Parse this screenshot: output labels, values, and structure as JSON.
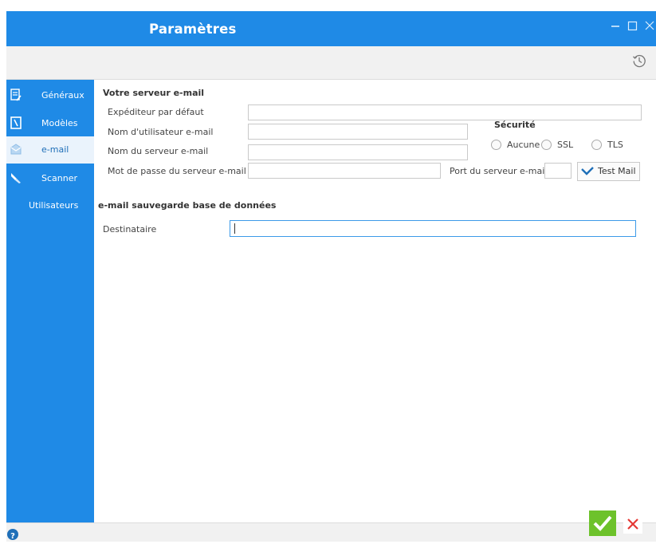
{
  "window": {
    "title": "Paramètres",
    "controls": [
      "minimize",
      "maximize",
      "close"
    ]
  },
  "toolbar": {
    "history_icon": "history-icon"
  },
  "sidebar": {
    "items": [
      {
        "label": "Généraux",
        "icon": "document-edit-icon",
        "active": false
      },
      {
        "label": "Modèles",
        "icon": "template-icon",
        "active": false
      },
      {
        "label": "e-mail",
        "icon": "envelope-icon",
        "active": true
      },
      {
        "label": "Scanner",
        "icon": "scanner-icon",
        "active": false
      },
      {
        "label": "Utilisateurs",
        "icon": "",
        "active": false
      }
    ]
  },
  "mail_server": {
    "title": "Votre serveur e-mail",
    "sender_label": "Expéditeur par défaut",
    "sender_value": "",
    "username_label": "Nom d'utilisateur e-mail",
    "username_value": "",
    "server_name_label": "Nom du serveur e-mail",
    "server_name_value": "",
    "password_label": "Mot de passe du serveur e-mail",
    "password_value": "",
    "port_label": "Port du serveur e-mail",
    "port_value": "",
    "test_button_label": "Test Mail",
    "security": {
      "title": "Sécurité",
      "options": [
        "Aucune",
        "SSL",
        "TLS"
      ],
      "selected": ""
    }
  },
  "backup": {
    "title": "e-mail sauvegarde base de données",
    "recipient_label": "Destinataire",
    "recipient_value": ""
  },
  "footer": {
    "help_icon": "help-icon",
    "confirm_icon": "checkmark-icon",
    "cancel_icon": "close-icon"
  },
  "colors": {
    "accent": "#1f8ae6",
    "confirm": "#6dc22b",
    "cancel": "#e53935"
  }
}
